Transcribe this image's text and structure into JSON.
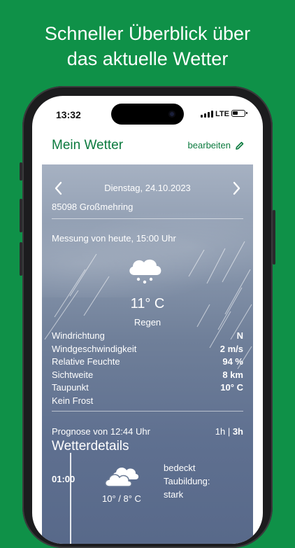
{
  "headline": {
    "line1": "Schneller Überblick über",
    "line2": "das aktuelle Wetter"
  },
  "status": {
    "time": "13:32",
    "network": "LTE"
  },
  "appbar": {
    "title": "Mein Wetter",
    "edit_label": "bearbeiten"
  },
  "weather": {
    "date": "Dienstag, 24.10.2023",
    "location": "85098 Großmehring",
    "measurement_label": "Messung von heute, 15:00 Uhr",
    "temperature": "11° C",
    "condition": "Regen",
    "rows": [
      {
        "label": "Windrichtung",
        "value": "N"
      },
      {
        "label": "Windgeschwindigkeit",
        "value": "2 m/s"
      },
      {
        "label": "Relative Feuchte",
        "value": "94 %"
      },
      {
        "label": "Sichtweite",
        "value": "8 km"
      },
      {
        "label": "Taupunkt",
        "value": "10° C"
      },
      {
        "label": "Kein Frost",
        "value": ""
      }
    ]
  },
  "forecast": {
    "label": "Prognose von 12:44 Uhr",
    "hours_1h": "1h",
    "hours_sep": " | ",
    "hours_3h": "3h",
    "title": "Wetterdetails",
    "items": [
      {
        "time": "01:00",
        "temp": "10° / 8° C",
        "desc1": "bedeckt",
        "desc2": "Taubildung:",
        "desc3": "stark"
      }
    ]
  },
  "icons": {
    "weather": "rain-cloud-icon",
    "forecast": "overcast-cloud-icon",
    "edit": "pencil-icon"
  },
  "colors": {
    "background": "#0f9148",
    "accent": "#0b7a3e"
  }
}
